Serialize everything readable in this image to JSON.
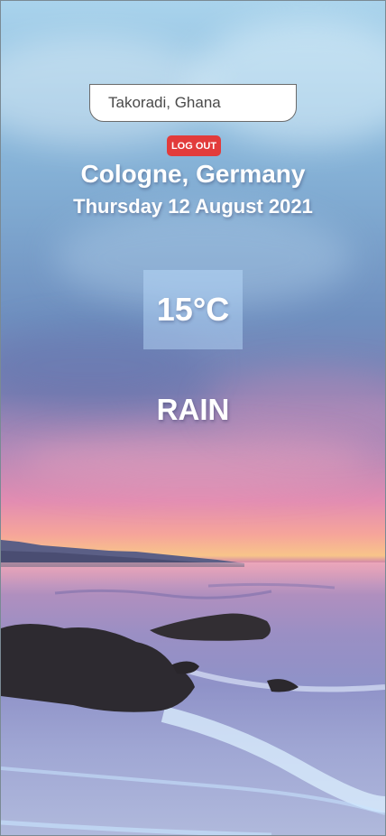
{
  "search": {
    "placeholder": "Takoradi, Ghana",
    "value": ""
  },
  "auth": {
    "logout_label": "LOG OUT"
  },
  "weather": {
    "location": "Cologne, Germany",
    "date": "Thursday 12 August 2021",
    "temperature": "15°C",
    "condition": "RAIN"
  },
  "background": {
    "description_icon": "beach-sunset-background"
  },
  "colors": {
    "logout_button": "#e23b3b",
    "text": "#ffffff",
    "temp_box": "#bee1ff"
  }
}
